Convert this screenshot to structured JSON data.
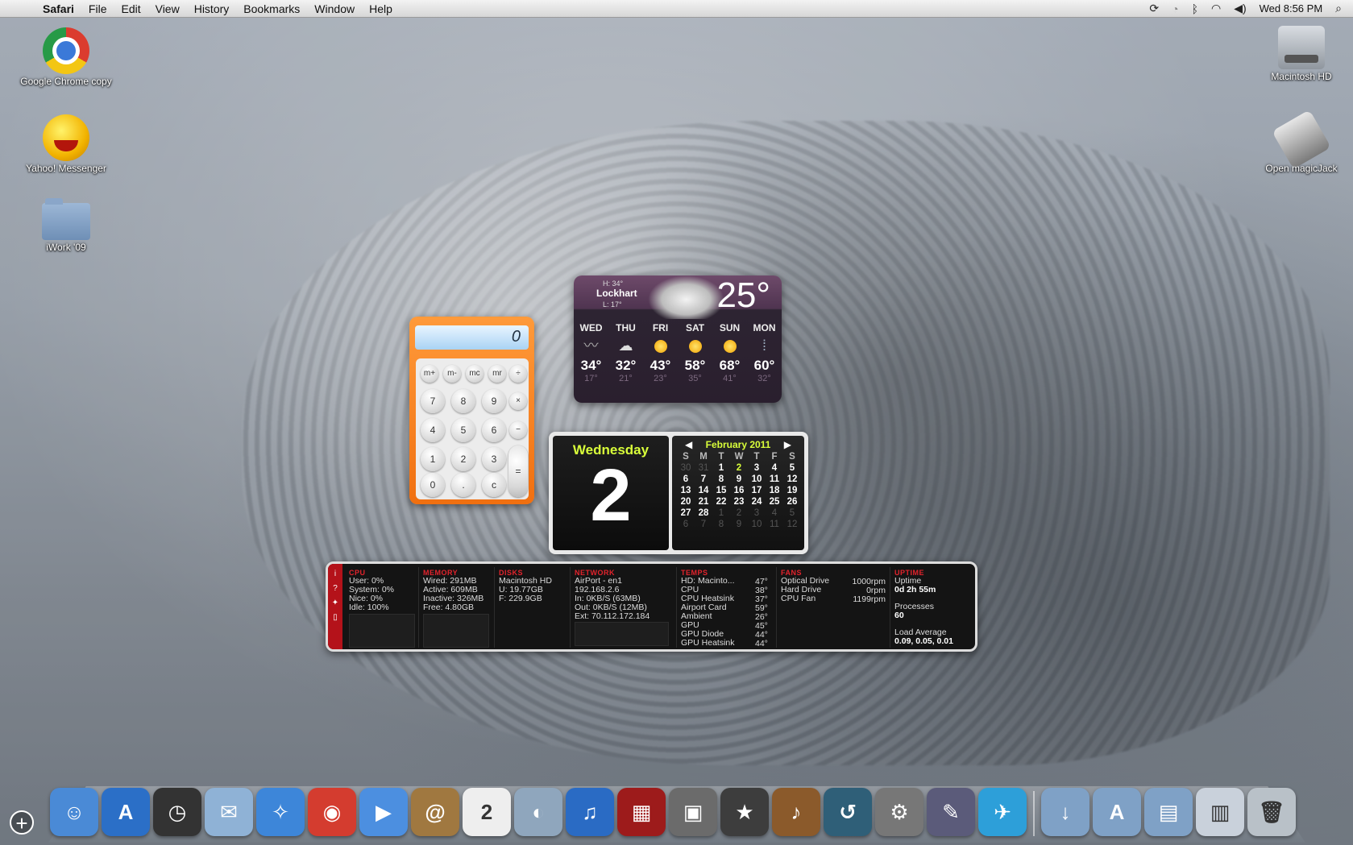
{
  "menubar": {
    "app": "Safari",
    "menus": [
      "File",
      "Edit",
      "View",
      "History",
      "Bookmarks",
      "Window",
      "Help"
    ],
    "clock": "Wed 8:56 PM"
  },
  "desktop": {
    "left_icons": [
      {
        "label": "Google Chrome copy",
        "icon": "chrome-icon"
      },
      {
        "label": "Yahoo! Messenger",
        "icon": "yahoo-messenger-icon"
      },
      {
        "label": "iWork '09",
        "icon": "folder-icon"
      }
    ],
    "right_icons": [
      {
        "label": "Macintosh HD",
        "icon": "hard-drive-icon"
      },
      {
        "label": "Open magicJack",
        "icon": "magicjack-icon"
      }
    ]
  },
  "calculator": {
    "display": "0",
    "memory_keys": [
      "m+",
      "m-",
      "mc",
      "mr",
      "÷"
    ],
    "rows": [
      [
        "7",
        "8",
        "9",
        "×"
      ],
      [
        "4",
        "5",
        "6",
        "−"
      ],
      [
        "1",
        "2",
        "3",
        "+"
      ],
      [
        "0",
        ".",
        "c",
        "="
      ]
    ]
  },
  "weather": {
    "city": "Lockhart",
    "high": "H: 34°",
    "low": "L: 17°",
    "current_temp": "25°",
    "forecast": [
      {
        "day": "WED",
        "hi": "34°",
        "lo": "17°",
        "icon": "wind-icon"
      },
      {
        "day": "THU",
        "hi": "32°",
        "lo": "21°",
        "icon": "cloudy-icon"
      },
      {
        "day": "FRI",
        "hi": "43°",
        "lo": "23°",
        "icon": "partly-sunny-icon"
      },
      {
        "day": "SAT",
        "hi": "58°",
        "lo": "35°",
        "icon": "sunny-icon"
      },
      {
        "day": "SUN",
        "hi": "68°",
        "lo": "41°",
        "icon": "sunny-icon"
      },
      {
        "day": "MON",
        "hi": "60°",
        "lo": "32°",
        "icon": "rain-icon"
      }
    ]
  },
  "calendar": {
    "weekday": "Wednesday",
    "day": "2",
    "month_title": "February 2011",
    "headers": [
      "S",
      "M",
      "T",
      "W",
      "T",
      "F",
      "S"
    ],
    "cells": [
      [
        "30",
        "o"
      ],
      [
        "31",
        "o"
      ],
      [
        "1",
        ""
      ],
      [
        "2",
        "t"
      ],
      [
        "3",
        ""
      ],
      [
        "4",
        ""
      ],
      [
        "5",
        ""
      ],
      [
        "6",
        ""
      ],
      [
        "7",
        ""
      ],
      [
        "8",
        ""
      ],
      [
        "9",
        ""
      ],
      [
        "10",
        ""
      ],
      [
        "11",
        ""
      ],
      [
        "12",
        ""
      ],
      [
        "13",
        ""
      ],
      [
        "14",
        ""
      ],
      [
        "15",
        ""
      ],
      [
        "16",
        ""
      ],
      [
        "17",
        ""
      ],
      [
        "18",
        ""
      ],
      [
        "19",
        ""
      ],
      [
        "20",
        ""
      ],
      [
        "21",
        ""
      ],
      [
        "22",
        ""
      ],
      [
        "23",
        ""
      ],
      [
        "24",
        ""
      ],
      [
        "25",
        ""
      ],
      [
        "26",
        ""
      ],
      [
        "27",
        ""
      ],
      [
        "28",
        ""
      ],
      [
        "1",
        "o"
      ],
      [
        "2",
        "o"
      ],
      [
        "3",
        "o"
      ],
      [
        "4",
        "o"
      ],
      [
        "5",
        "o"
      ],
      [
        "6",
        "o"
      ],
      [
        "7",
        "o"
      ],
      [
        "8",
        "o"
      ],
      [
        "9",
        "o"
      ],
      [
        "10",
        "o"
      ],
      [
        "11",
        "o"
      ],
      [
        "12",
        "o"
      ]
    ]
  },
  "istat": {
    "cpu": {
      "title": "CPU",
      "user": "User: 0%",
      "system": "System: 0%",
      "nice": "Nice: 0%",
      "idle": "Idle: 100%"
    },
    "memory": {
      "title": "MEMORY",
      "wired": "Wired: 291MB",
      "active": "Active: 609MB",
      "inactive": "Inactive: 326MB",
      "free": "Free: 4.80GB"
    },
    "disks": {
      "title": "DISKS",
      "name": "Macintosh HD",
      "used": "U: 19.77GB",
      "free": "F: 229.9GB"
    },
    "network": {
      "title": "NETWORK",
      "iface": "AirPort - en1",
      "ip": "192.168.2.6",
      "in": "In: 0KB/S (63MB)",
      "out": "Out: 0KB/S (12MB)",
      "ext": "Ext: 70.112.172.184"
    },
    "temps": {
      "title": "TEMPS",
      "items": [
        [
          "HD: Macinto...",
          "47°"
        ],
        [
          "CPU",
          "38°"
        ],
        [
          "CPU Heatsink",
          "37°"
        ],
        [
          "Airport Card",
          "59°"
        ],
        [
          "Ambient",
          "26°"
        ],
        [
          "GPU",
          "45°"
        ],
        [
          "GPU Diode",
          "44°"
        ],
        [
          "GPU Heatsink",
          "44°"
        ]
      ]
    },
    "fans": {
      "title": "FANS",
      "items": [
        [
          "Optical Drive",
          "1000rpm"
        ],
        [
          "Hard Drive",
          "0rpm"
        ],
        [
          "CPU Fan",
          "1199rpm"
        ]
      ]
    },
    "uptime": {
      "title": "UPTIME",
      "label": "Uptime",
      "value": "0d 2h 55m",
      "proc_label": "Processes",
      "proc": "60",
      "load_label": "Load Average",
      "load": "0.09, 0.05, 0.01"
    }
  },
  "dock": [
    {
      "name": "finder-icon",
      "color": "#4a8ad6",
      "glyph": "☺"
    },
    {
      "name": "app-store-icon",
      "color": "#2b6fc7",
      "glyph": "A"
    },
    {
      "name": "dashboard-icon",
      "color": "#333",
      "glyph": "◷"
    },
    {
      "name": "mail-icon",
      "color": "#8fb2d6",
      "glyph": "✉"
    },
    {
      "name": "safari-icon",
      "color": "#3d86d9",
      "glyph": "✧"
    },
    {
      "name": "chrome-dock-icon",
      "color": "#d43c2f",
      "glyph": "◉"
    },
    {
      "name": "ichat-icon",
      "color": "#4c8fe0",
      "glyph": "▶"
    },
    {
      "name": "address-book-icon",
      "color": "#a07840",
      "glyph": "@"
    },
    {
      "name": "ical-icon",
      "color": "#eee",
      "glyph": "2"
    },
    {
      "name": "preview-icon",
      "color": "#8fa6bd",
      "glyph": "◐"
    },
    {
      "name": "itunes-icon",
      "color": "#2a6bc4",
      "glyph": "♫"
    },
    {
      "name": "photo-booth-icon",
      "color": "#9d1b1b",
      "glyph": "▦"
    },
    {
      "name": "iphoto-icon",
      "color": "#6b6b6b",
      "glyph": "▣"
    },
    {
      "name": "imovie-icon",
      "color": "#3d3d3d",
      "glyph": "★"
    },
    {
      "name": "garageband-icon",
      "color": "#8b5a2b",
      "glyph": "♪"
    },
    {
      "name": "time-machine-icon",
      "color": "#2f5f78",
      "glyph": "↺"
    },
    {
      "name": "system-preferences-icon",
      "color": "#777",
      "glyph": "⚙"
    },
    {
      "name": "script-editor-icon",
      "color": "#5b5b7a",
      "glyph": "✎"
    },
    {
      "name": "twitter-icon",
      "color": "#2d9fd9",
      "glyph": "✈"
    },
    {
      "name": "downloads-stack-icon",
      "color": "#7fa1c6",
      "glyph": "↓"
    },
    {
      "name": "applications-stack-icon",
      "color": "#7fa1c6",
      "glyph": "A"
    },
    {
      "name": "documents-stack-icon",
      "color": "#7fa1c6",
      "glyph": "▤"
    },
    {
      "name": "recent-stack-icon",
      "color": "#c9d1db",
      "glyph": "▥"
    },
    {
      "name": "trash-icon",
      "color": "#b9c1c8",
      "glyph": "🗑"
    }
  ]
}
